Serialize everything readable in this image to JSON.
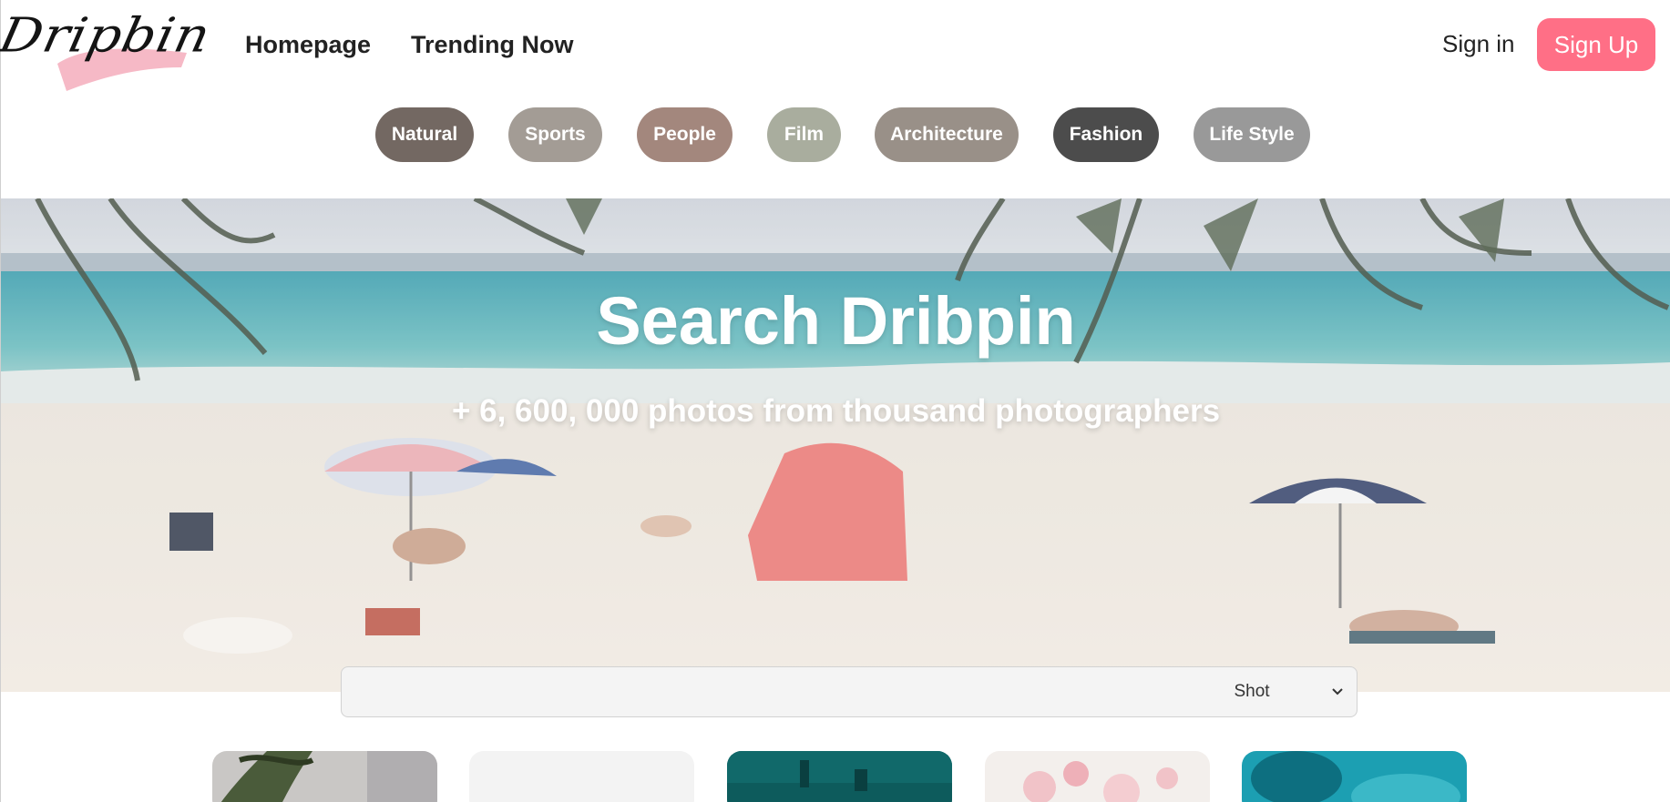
{
  "brand": {
    "logo_text": "Dripbin",
    "accent": "#ff6f86",
    "brush_color": "#f6b9c6"
  },
  "nav": {
    "home_label": "Homepage",
    "trending_label": "Trending Now"
  },
  "auth": {
    "signin_label": "Sign in",
    "signup_label": "Sign Up"
  },
  "categories": [
    {
      "label": "Natural",
      "color": "#736862"
    },
    {
      "label": "Sports",
      "color": "#a39c95"
    },
    {
      "label": "People",
      "color": "#a3877d"
    },
    {
      "label": "Film",
      "color": "#a9ad9e"
    },
    {
      "label": "Architecture",
      "color": "#999088"
    },
    {
      "label": "Fashion",
      "color": "#4c4c4c"
    },
    {
      "label": "Life Style",
      "color": "#999999"
    }
  ],
  "hero": {
    "title": "Search Dribpin",
    "subtitle": "+ 6, 600, 000 photos from thousand photographers"
  },
  "search": {
    "value": "",
    "placeholder": "",
    "type_selected": "Shot"
  },
  "thumbnails": [
    {
      "name": "plant-window"
    },
    {
      "name": "light-grey"
    },
    {
      "name": "teal-water"
    },
    {
      "name": "cherry-blossom"
    },
    {
      "name": "turquoise"
    }
  ]
}
